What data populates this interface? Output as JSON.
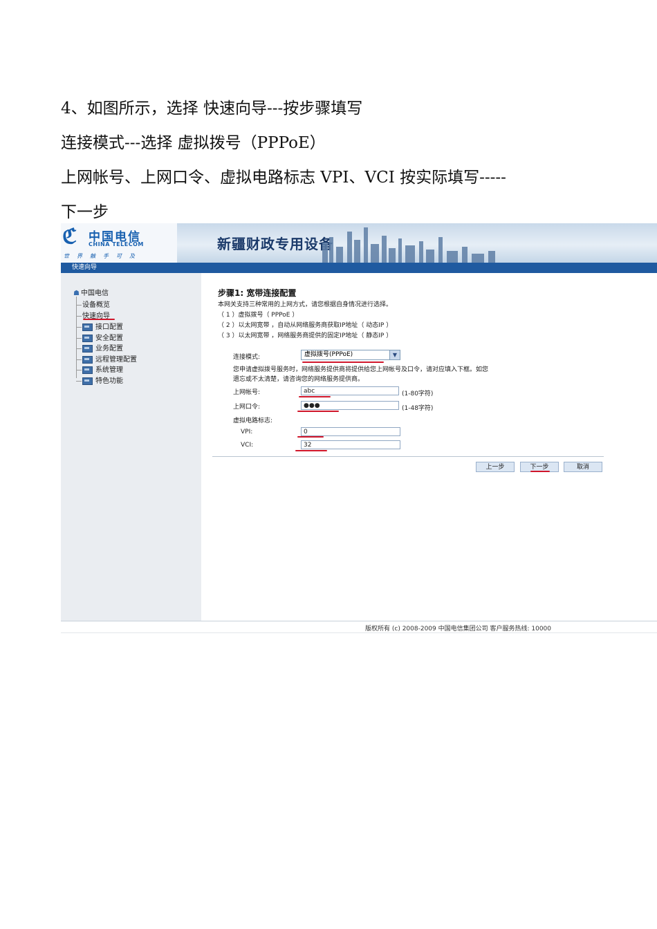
{
  "document": {
    "lines": [
      "4、如图所示，选择  快速向导---按步骤填写",
      "连接模式---选择  虚拟拨号（PPPoE）",
      "上网帐号、上网口令、虚拟电路标志 VPI、VCI 按实际填写-----",
      "下一步"
    ]
  },
  "header": {
    "logo_cn": "中国电信",
    "logo_en": "CHINA TELECOM",
    "logo_slogan": "世界触手可及",
    "banner_title": "新疆财政专用设备",
    "menubar_label": "快速向导"
  },
  "sidebar": {
    "root": "中国电信",
    "items": [
      {
        "label": "设备概览",
        "icon": "none"
      },
      {
        "label": "快速向导",
        "icon": "none"
      },
      {
        "label": "接口配置",
        "icon": "folder-icon"
      },
      {
        "label": "安全配置",
        "icon": "folder-icon"
      },
      {
        "label": "业务配置",
        "icon": "folder-icon"
      },
      {
        "label": "远程管理配置",
        "icon": "folder-icon"
      },
      {
        "label": "系统管理",
        "icon": "folder-icon"
      },
      {
        "label": "特色功能",
        "icon": "folder-icon"
      }
    ]
  },
  "main": {
    "step_title": "步骤1: 宽带连接配置",
    "intro": "本网关支持三种常用的上网方式，请您根据自身情况进行选择。",
    "options": [
      "（ 1 ）虚拟拨号（ PPPoE ）",
      "（ 2 ）以太网宽带    ，自动从网络服务商获取IP地址（ 动态IP ）",
      "（ 3 ）以太网宽带    ，网络服务商提供的固定IP地址（ 静态IP ）"
    ],
    "mode_label": "连接模式:",
    "mode_value": "虚拟拨号(PPPoE)",
    "hint_line1": "您申请虚拟拨号服务时，网络服务提供商将提供给您上网帐号及口令，请对应填入下框。如您",
    "hint_line2": "遗忘或不太清楚，请咨询您的网络服务提供商。",
    "account_label": "上网帐号:",
    "account_value": "abc",
    "account_hint": "(1-80字符)",
    "password_label": "上网口令:",
    "password_value": "●●●",
    "password_hint": "(1-48字符)",
    "vc_label": "虚拟电路标志:",
    "vpi_label": "VPI:",
    "vpi_value": "0",
    "vci_label": "VCI:",
    "vci_value": "32",
    "prev_button": "上一步",
    "next_button": "下一步",
    "cancel_button": "取消"
  },
  "footer": {
    "copyright": "版权所有 (c) 2008-2009  中国电信集团公司  客户服务热线: 10000"
  },
  "colors": {
    "annotation_underline": "#d0162a",
    "menubar": "#1f5aa0",
    "brand_blue": "#1760b0"
  }
}
